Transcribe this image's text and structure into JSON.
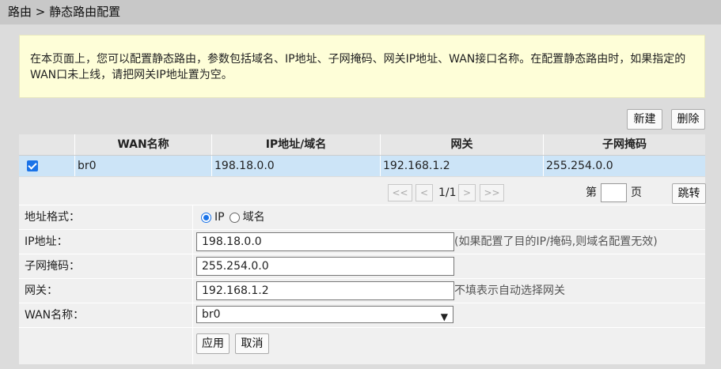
{
  "breadcrumb": "路由 > 静态路由配置",
  "info_text": "在本页面上，您可以配置静态路由，参数包括域名、IP地址、子网掩码、网关IP地址、WAN接口名称。在配置静态路由时，如果指定的WAN口未上线，请把网关IP地址置为空。",
  "toolbar": {
    "new_label": "新建",
    "delete_label": "删除"
  },
  "table": {
    "headers": [
      "",
      "WAN名称",
      "IP地址/域名",
      "网关",
      "子网掩码"
    ],
    "rows": [
      {
        "checked": true,
        "wan": "br0",
        "ip": "198.18.0.0",
        "gateway": "192.168.1.2",
        "mask": "255.254.0.0"
      }
    ]
  },
  "pager": {
    "first": "<<",
    "prev": "<",
    "page_info": "1/1",
    "next": ">",
    "last": ">>",
    "goto_prefix": "第",
    "goto_suffix": "页",
    "goto_value": "",
    "jump_label": "跳转"
  },
  "form": {
    "addr_format_label": "地址格式：",
    "radio_ip": "IP",
    "radio_domain": "域名",
    "selected_format": "IP",
    "ip_label": "IP地址：",
    "ip_value": "198.18.0.0",
    "ip_note": "(如果配置了目的IP/掩码,则域名配置无效)",
    "mask_label": "子网掩码：",
    "mask_value": "255.254.0.0",
    "gateway_label": "网关：",
    "gateway_value": "192.168.1.2",
    "gateway_note": "不填表示自动选择网关",
    "wan_label": "WAN名称：",
    "wan_value": "br0",
    "apply_label": "应用",
    "cancel_label": "取消"
  },
  "colors": {
    "selected_row": "#cce4f7",
    "accent": "#1a73e8",
    "info_bg": "#fefed8"
  }
}
